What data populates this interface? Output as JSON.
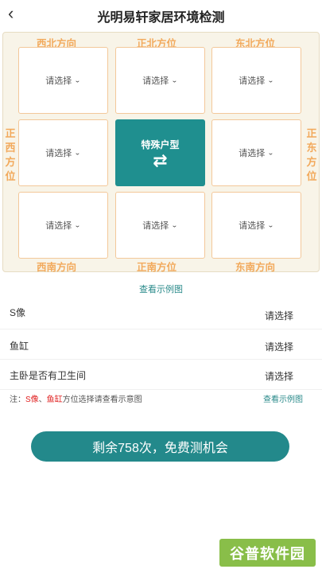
{
  "header": {
    "back_icon": "back-chevron-icon",
    "title": "光明易轩家居环境检测"
  },
  "board": {
    "directions": {
      "northwest": "西北方向",
      "north": "正北方位",
      "northeast": "东北方位",
      "west": "正西方位",
      "east": "正东方位",
      "southwest": "西南方向",
      "south": "正南方位",
      "southeast": "东南方向"
    },
    "placeholder": "请选择",
    "chevron": "⌄",
    "center": {
      "label": "特殊户型",
      "swap_icon": "⇄"
    },
    "colors": {
      "accent": "#1f8f8f",
      "direction_text": "#f2a95b",
      "cell_border": "#f3c89a",
      "board_bg": "#f8f4e8"
    }
  },
  "example_link": "查看示例图",
  "rows": [
    {
      "label": "S像",
      "value": "请选择"
    },
    {
      "label": "鱼缸",
      "value": "请选择"
    },
    {
      "label": "主卧是否有卫生间",
      "value": "请选择"
    }
  ],
  "note": {
    "prefix": "注：",
    "hl1": "S像",
    "sep": "、",
    "hl2": "鱼缸",
    "suffix": "方位选择请查看示意图",
    "link": "查看示例图"
  },
  "cta": {
    "label": "剩余758次，免费测机会",
    "color": "#23898b"
  },
  "watermark": "谷普软件园"
}
